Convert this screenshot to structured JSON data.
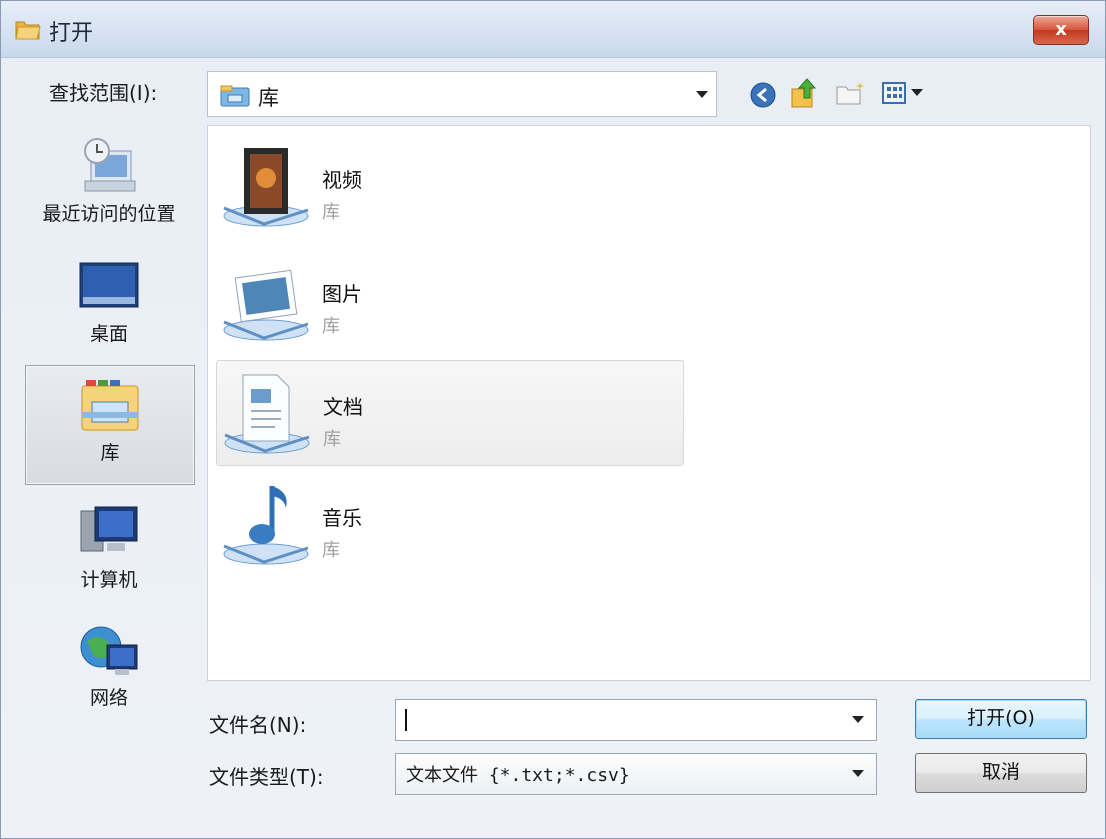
{
  "window": {
    "title": "打开",
    "close_label": "x"
  },
  "toolbar": {
    "lookin_label": "查找范围(I):",
    "lookin_value": "库",
    "icons": [
      "back-icon",
      "up-folder-icon",
      "new-folder-icon",
      "view-menu-icon"
    ]
  },
  "places": [
    {
      "label": "最近访问的位置",
      "icon": "recent-places-icon",
      "selected": false
    },
    {
      "label": "桌面",
      "icon": "desktop-icon",
      "selected": false
    },
    {
      "label": "库",
      "icon": "libraries-icon",
      "selected": true
    },
    {
      "label": "计算机",
      "icon": "computer-icon",
      "selected": false
    },
    {
      "label": "网络",
      "icon": "network-icon",
      "selected": false
    }
  ],
  "libraries": [
    {
      "name": "视频",
      "type": "库",
      "icon": "videos-library-icon"
    },
    {
      "name": "图片",
      "type": "库",
      "icon": "pictures-library-icon"
    },
    {
      "name": "文档",
      "type": "库",
      "icon": "documents-library-icon",
      "hovered": true
    },
    {
      "name": "音乐",
      "type": "库",
      "icon": "music-library-icon"
    }
  ],
  "filename": {
    "label": "文件名(N):",
    "value": ""
  },
  "filetype": {
    "label": "文件类型(T):",
    "value": "文本文件 {*.txt;*.csv}"
  },
  "buttons": {
    "open": "打开(O)",
    "cancel": "取消"
  },
  "colors": {
    "accent": "#3c7fb1",
    "close": "#c0391f",
    "selection": "#d8dce2"
  }
}
